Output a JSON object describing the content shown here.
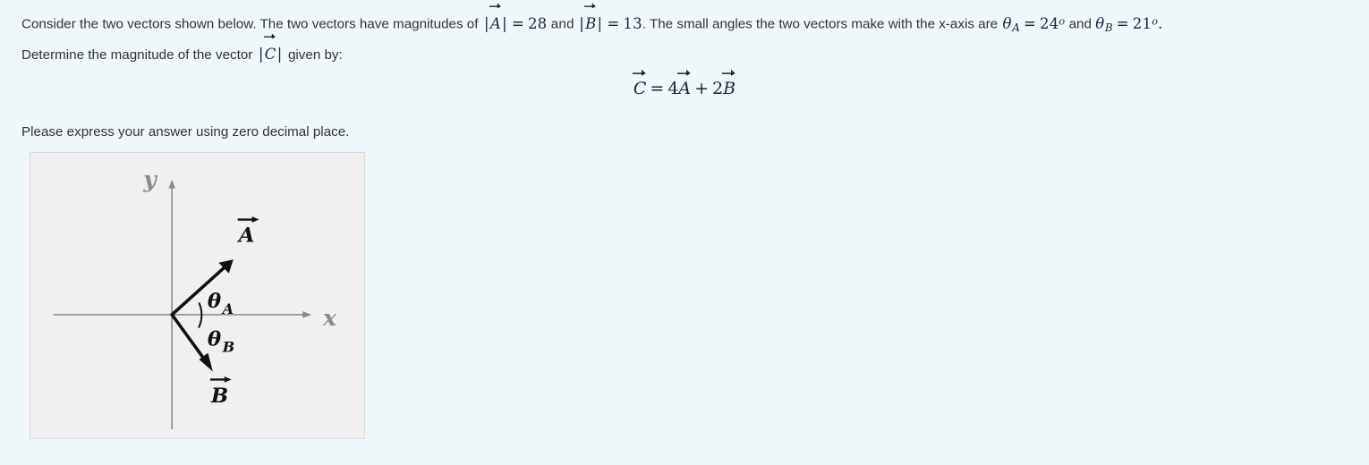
{
  "problem": {
    "line1_part1": "Consider the two vectors shown below. The two vectors have magnitudes of",
    "mag_a_symbol": "A",
    "mag_a_value": "28",
    "line1_and": "and",
    "mag_b_symbol": "B",
    "mag_b_value": "13",
    "line1_part2": ".  The small angles the two vectors make with the x-axis are",
    "theta_a_symbol": "θ",
    "theta_a_sub": "A",
    "theta_a_value": "24",
    "theta_b_symbol": "θ",
    "theta_b_sub": "B",
    "theta_b_value": "21",
    "degree": "o",
    "equals": "=",
    "period": ".",
    "line2_part1": "Determine the magnitude of the vector",
    "mag_c_symbol": "C",
    "line2_part2": "given by:"
  },
  "equation": {
    "lhs": "C",
    "equals": "=",
    "coef_a": "4",
    "vec_a": "A",
    "plus": "+",
    "coef_b": "2",
    "vec_b": "B"
  },
  "instruction": {
    "text": "Please express your answer using zero decimal place."
  },
  "figure": {
    "x_axis_label": "x",
    "y_axis_label": "y",
    "vector_a_label": "A",
    "vector_b_label": "B",
    "theta_a_label": "θ",
    "theta_a_sub": "A",
    "theta_b_label": "θ",
    "theta_b_sub": "B",
    "panel_bg": "#f0f0ef",
    "axis_color": "#8a8a8a",
    "vector_color": "#111111",
    "page_bg": "#f0f7fb"
  }
}
